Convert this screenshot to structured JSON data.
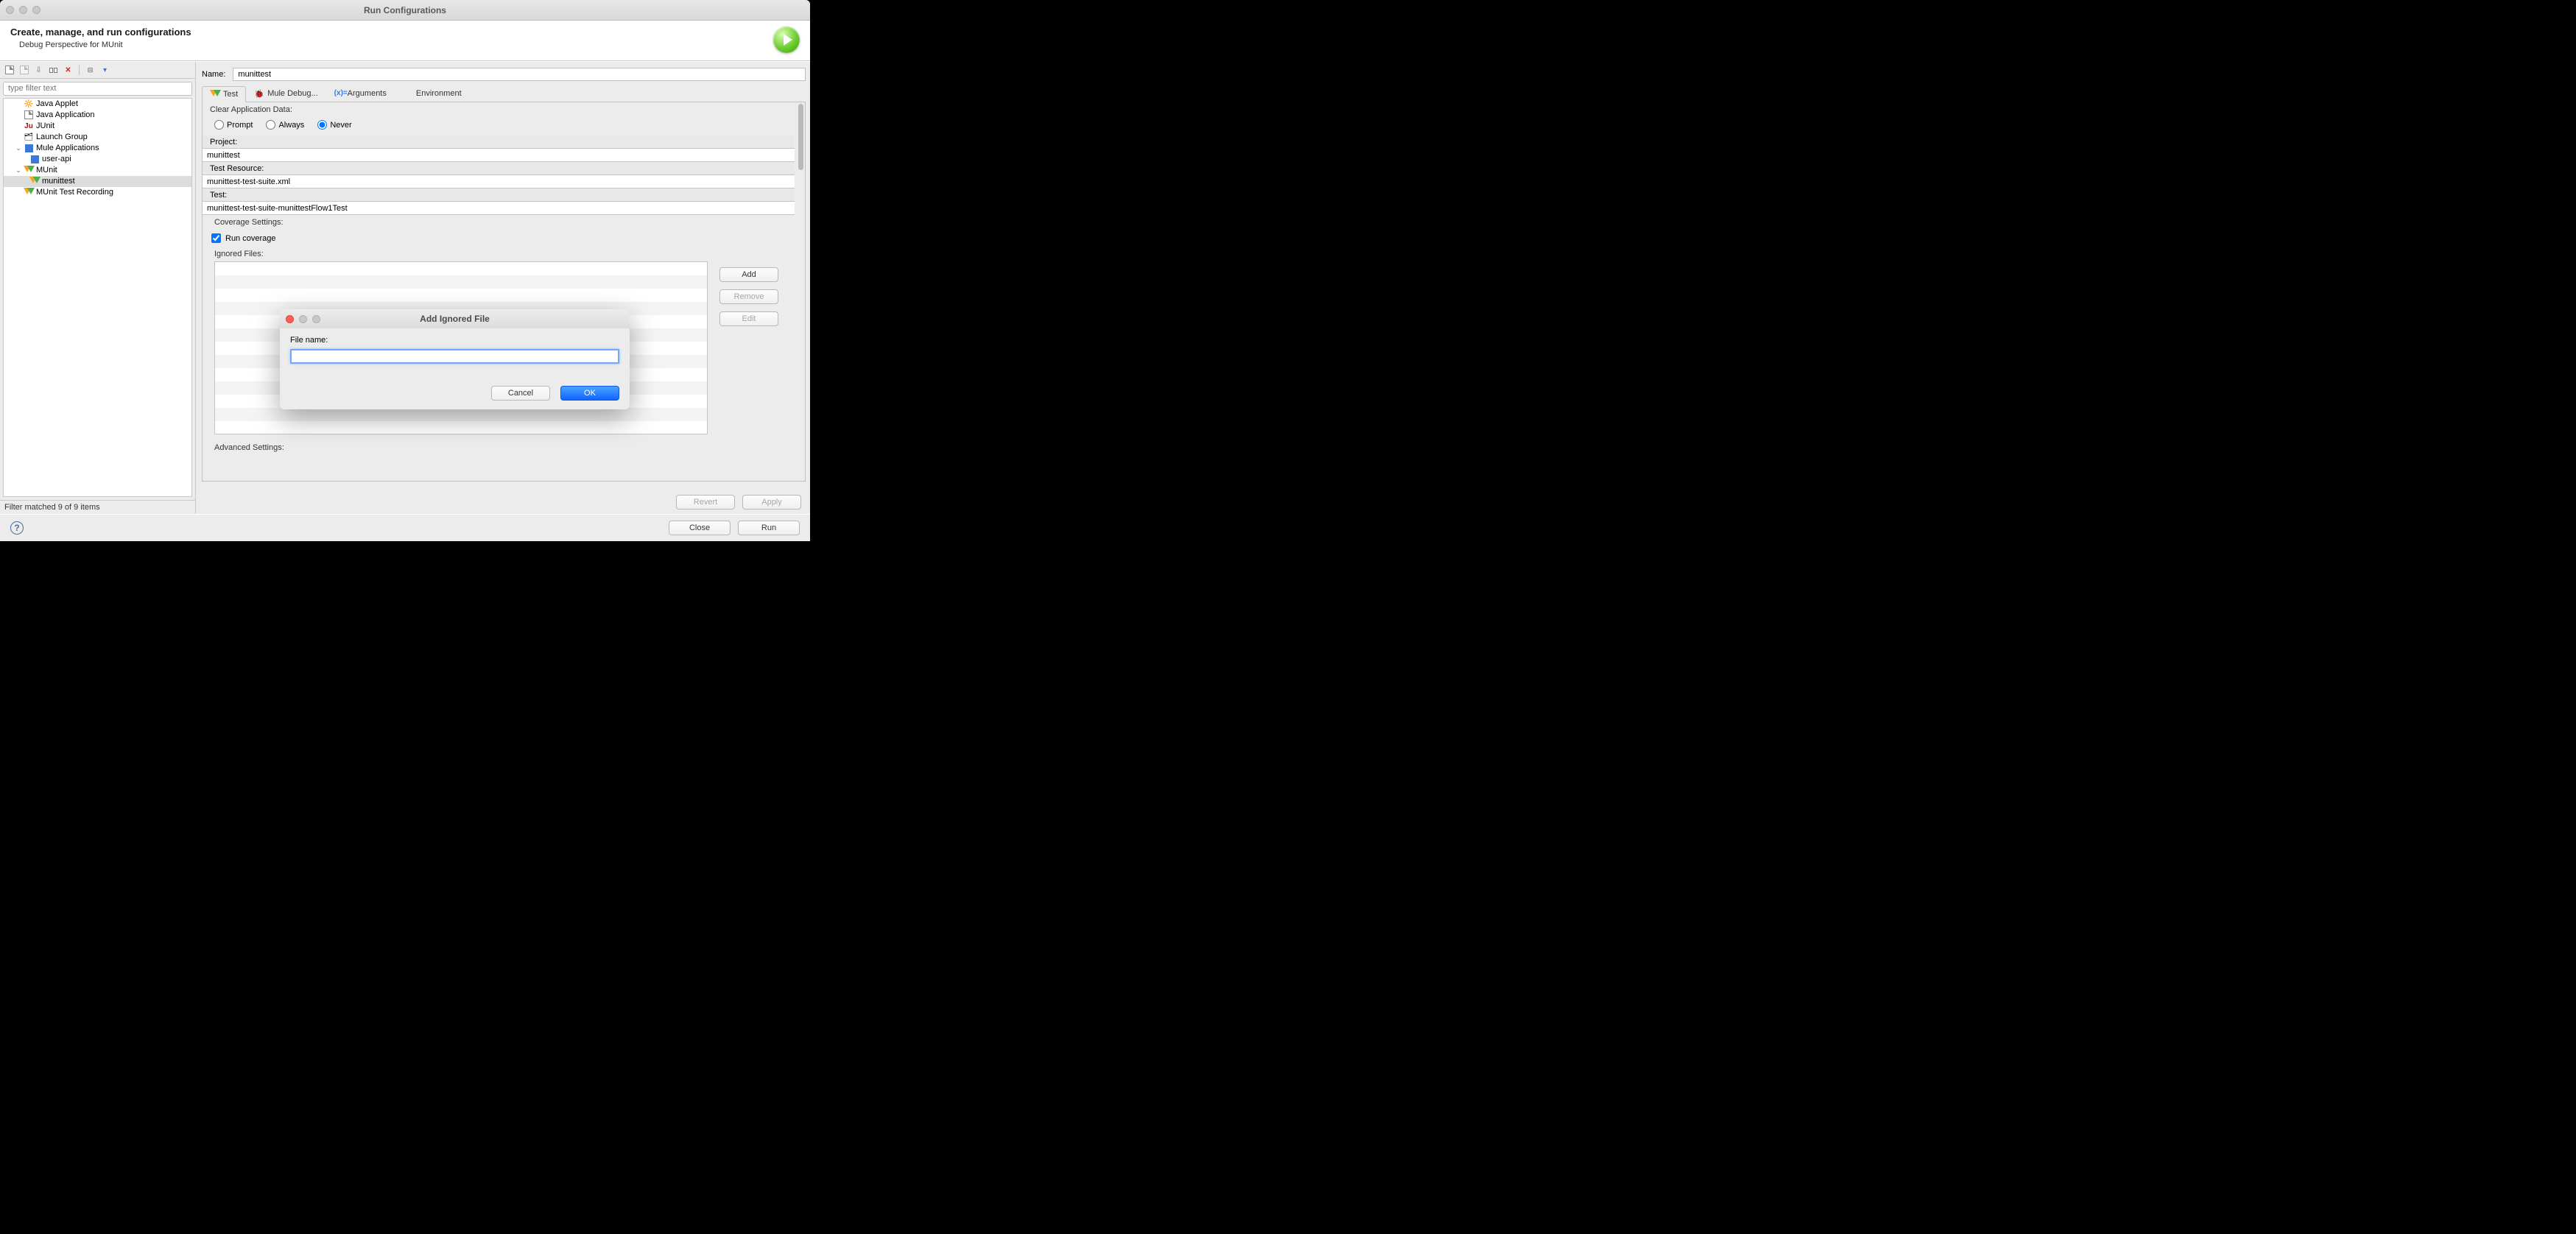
{
  "window": {
    "title": "Run Configurations"
  },
  "header": {
    "title": "Create, manage, and run configurations",
    "subtitle": "Debug Perspective for MUnit"
  },
  "sidebar": {
    "filter_placeholder": "type filter text",
    "items": [
      {
        "label": "Java Applet"
      },
      {
        "label": "Java Application"
      },
      {
        "label": "JUnit"
      },
      {
        "label": "Launch Group"
      },
      {
        "label": "Mule Applications"
      },
      {
        "label": "user-api"
      },
      {
        "label": "MUnit"
      },
      {
        "label": "munittest"
      },
      {
        "label": "MUnit Test Recording"
      }
    ],
    "status": "Filter matched 9 of 9 items"
  },
  "form": {
    "name_label": "Name:",
    "name_value": "munittest",
    "tabs": {
      "test": "Test",
      "debug": "Mule Debug...",
      "args": "Arguments",
      "env": "Environment"
    },
    "clear_label": "Clear Application Data:",
    "radios": {
      "prompt": "Prompt",
      "always": "Always",
      "never": "Never"
    },
    "selected_radio": "never",
    "project_label": "Project:",
    "project_value": "munittest",
    "resource_label": "Test Resource:",
    "resource_value": "munittest-test-suite.xml",
    "test_label": "Test:",
    "test_value": "munittest-test-suite-munittestFlow1Test",
    "coverage_label": "Coverage Settings:",
    "run_coverage_label": "Run coverage",
    "ignored_label": "Ignored Files:",
    "advanced_label": "Advanced Settings:",
    "buttons": {
      "add": "Add",
      "remove": "Remove",
      "edit": "Edit",
      "revert": "Revert",
      "apply": "Apply"
    }
  },
  "footer": {
    "close": "Close",
    "run": "Run"
  },
  "modal": {
    "title": "Add Ignored File",
    "file_label": "File name:",
    "file_value": "",
    "cancel": "Cancel",
    "ok": "OK"
  }
}
